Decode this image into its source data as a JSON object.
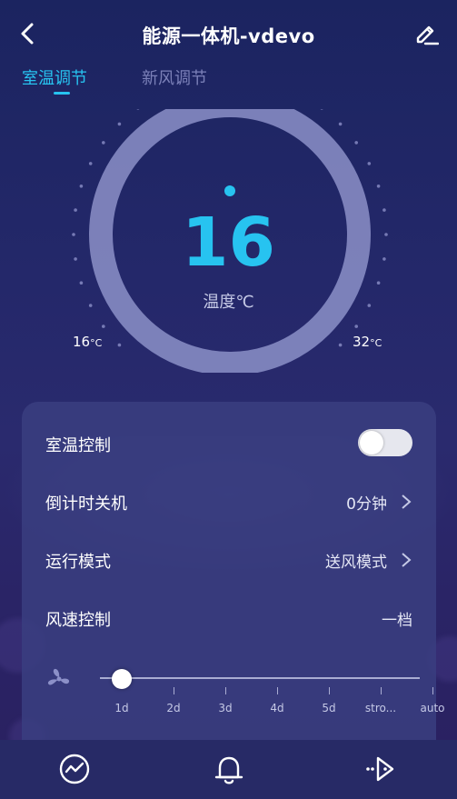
{
  "header": {
    "title": "能源一体机-vdevo",
    "back_icon": "chevron-left-icon",
    "edit_icon": "pencil-icon"
  },
  "tabs": [
    {
      "label": "室温调节",
      "active": true
    },
    {
      "label": "新风调节",
      "active": false
    }
  ],
  "dial": {
    "temperature": "16",
    "unit_label": "温度℃",
    "min_label": "16",
    "min_unit": "°C",
    "max_label": "32",
    "max_unit": "°C"
  },
  "settings": {
    "room_temp_control": {
      "label": "室温控制",
      "toggle_on": false
    },
    "countdown_off": {
      "label": "倒计时关机",
      "value": "0分钟"
    },
    "run_mode": {
      "label": "运行模式",
      "value": "送风模式"
    },
    "fan_speed": {
      "label": "风速控制",
      "value": "一档"
    }
  },
  "fan_slider": {
    "icon": "fan-icon",
    "options": [
      "1d",
      "2d",
      "3d",
      "4d",
      "5d",
      "stro...",
      "auto"
    ],
    "selected_index": 0
  },
  "bottom_nav": [
    {
      "icon": "chart-icon"
    },
    {
      "icon": "bell-icon"
    },
    {
      "icon": "more-play-icon"
    }
  ],
  "colors": {
    "accent": "#27c3f0",
    "background": "#24286a"
  }
}
